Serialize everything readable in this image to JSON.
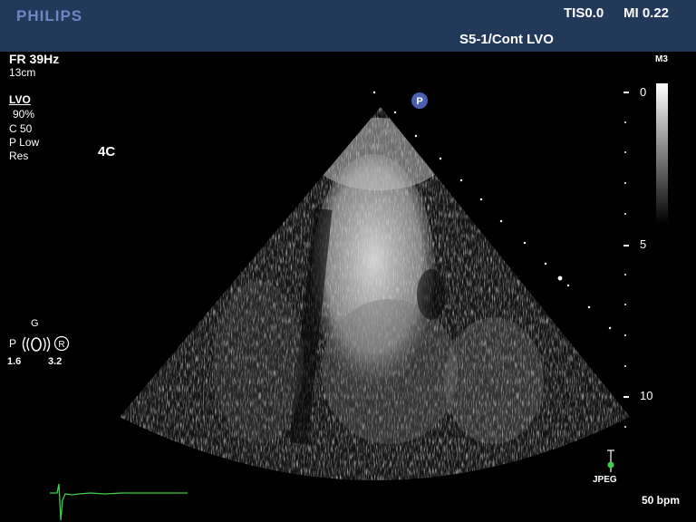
{
  "header": {
    "brand": "PHILIPS",
    "tis": "TIS0.0",
    "mi": "MI 0.22",
    "probe_preset": "S5-1/Cont LVO"
  },
  "left_panel": {
    "frame_rate": "FR 39Hz",
    "depth": "13cm",
    "mode": "LVO",
    "power": "90%",
    "compression": "C 50",
    "persistence": "P Low",
    "optimization": "Res",
    "view": "4C"
  },
  "transducer_controls": {
    "gain_label": "G",
    "left_label": "P",
    "right_label": "R",
    "freq_low": "1.6",
    "freq_high": "3.2"
  },
  "right_panel": {
    "map": "M3",
    "depth_ticks": [
      "0",
      "5",
      "10"
    ],
    "format": "JPEG",
    "heart_rate": "50 bpm"
  },
  "markers": {
    "orientation": "P"
  },
  "colors": {
    "header_bg": "#22395a",
    "brand": "#6f86c4",
    "ecg_trace": "#3fd04a",
    "orientation_marker": "#4a5fb0"
  }
}
